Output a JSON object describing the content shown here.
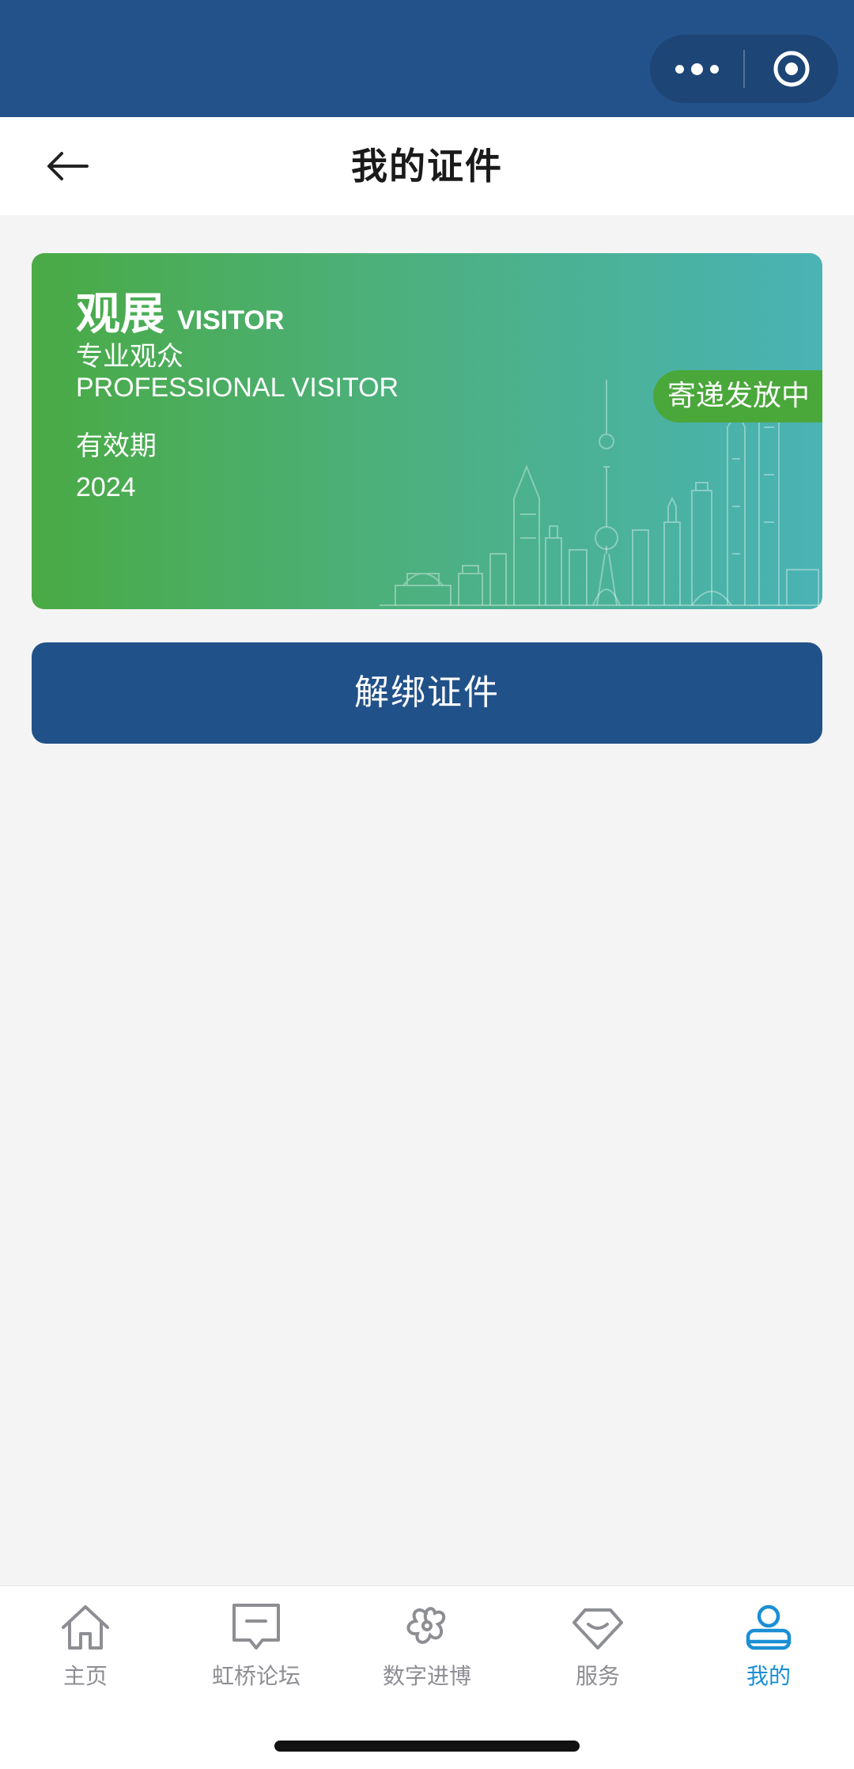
{
  "capsule": {
    "more_icon": "more-dots-icon",
    "close_icon": "target-circle-icon"
  },
  "nav": {
    "title": "我的证件",
    "back_icon": "arrow-left-icon"
  },
  "card": {
    "title_cn": "观展",
    "title_en": "VISITOR",
    "subtitle_cn": "专业观众",
    "subtitle_en": "PROFESSIONAL VISITOR",
    "valid_label": "有效期",
    "valid_year": "2024",
    "status_badge": "寄递发放中",
    "gradient_colors": [
      "#4aaa44",
      "#4ab3b5"
    ]
  },
  "actions": {
    "unbind_label": "解绑证件",
    "unbind_color": "#215189"
  },
  "tabbar": {
    "active_color": "#1a8fd4",
    "inactive_color": "#8d8e93",
    "items": [
      {
        "label": "主页",
        "icon": "home-icon"
      },
      {
        "label": "虹桥论坛",
        "icon": "forum-icon"
      },
      {
        "label": "数字进博",
        "icon": "flower-icon"
      },
      {
        "label": "服务",
        "icon": "service-icon"
      },
      {
        "label": "我的",
        "icon": "user-icon",
        "active": true
      }
    ]
  }
}
